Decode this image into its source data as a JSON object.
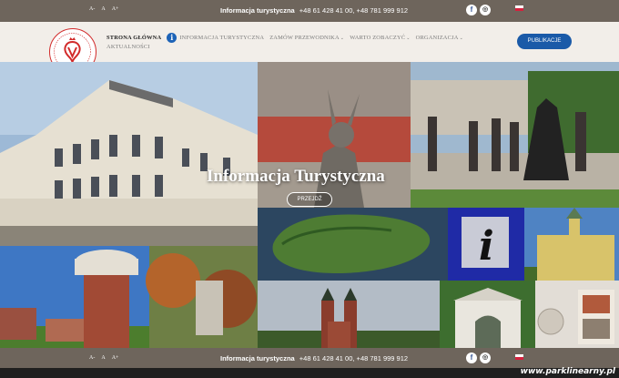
{
  "topbar": {
    "font_sizes": [
      "A-",
      "A",
      "A+"
    ],
    "info_label": "Informacja turystyczna",
    "phones": "+48 61 428 41 00, +48 781 999 912",
    "social": [
      {
        "icon": "facebook-icon",
        "glyph": "f"
      },
      {
        "icon": "instagram-icon",
        "glyph": "◎"
      }
    ],
    "language": "pl"
  },
  "header": {
    "logo_alt": "Gniezno",
    "nav": {
      "home": "STRONA GŁÓWNA",
      "info": "INFORMACJA TURYSTYCZNA",
      "guide": "ZAMÓW PRZEWODNIKA",
      "sights": "WARTO ZOBACZYĆ",
      "org": "ORGANIZACJA",
      "news": "AKTUALNOŚCI"
    },
    "publications_button": "PUBLIKACJE"
  },
  "hero": {
    "title": "Informacja Turystyczna",
    "button": "PRZEJDŹ"
  },
  "bottombar": {
    "font_sizes": [
      "A-",
      "A",
      "A+"
    ],
    "info_label": "Informacja turystyczna",
    "phones": "+48 61 428 41 00, +48 781 999 912"
  },
  "watermark": "www.parklinearny.pl",
  "colors": {
    "bar": "#6e655c",
    "header_bg": "#f2eee9",
    "accent_blue": "#1a5aa8",
    "logo_red": "#d22b2b"
  }
}
